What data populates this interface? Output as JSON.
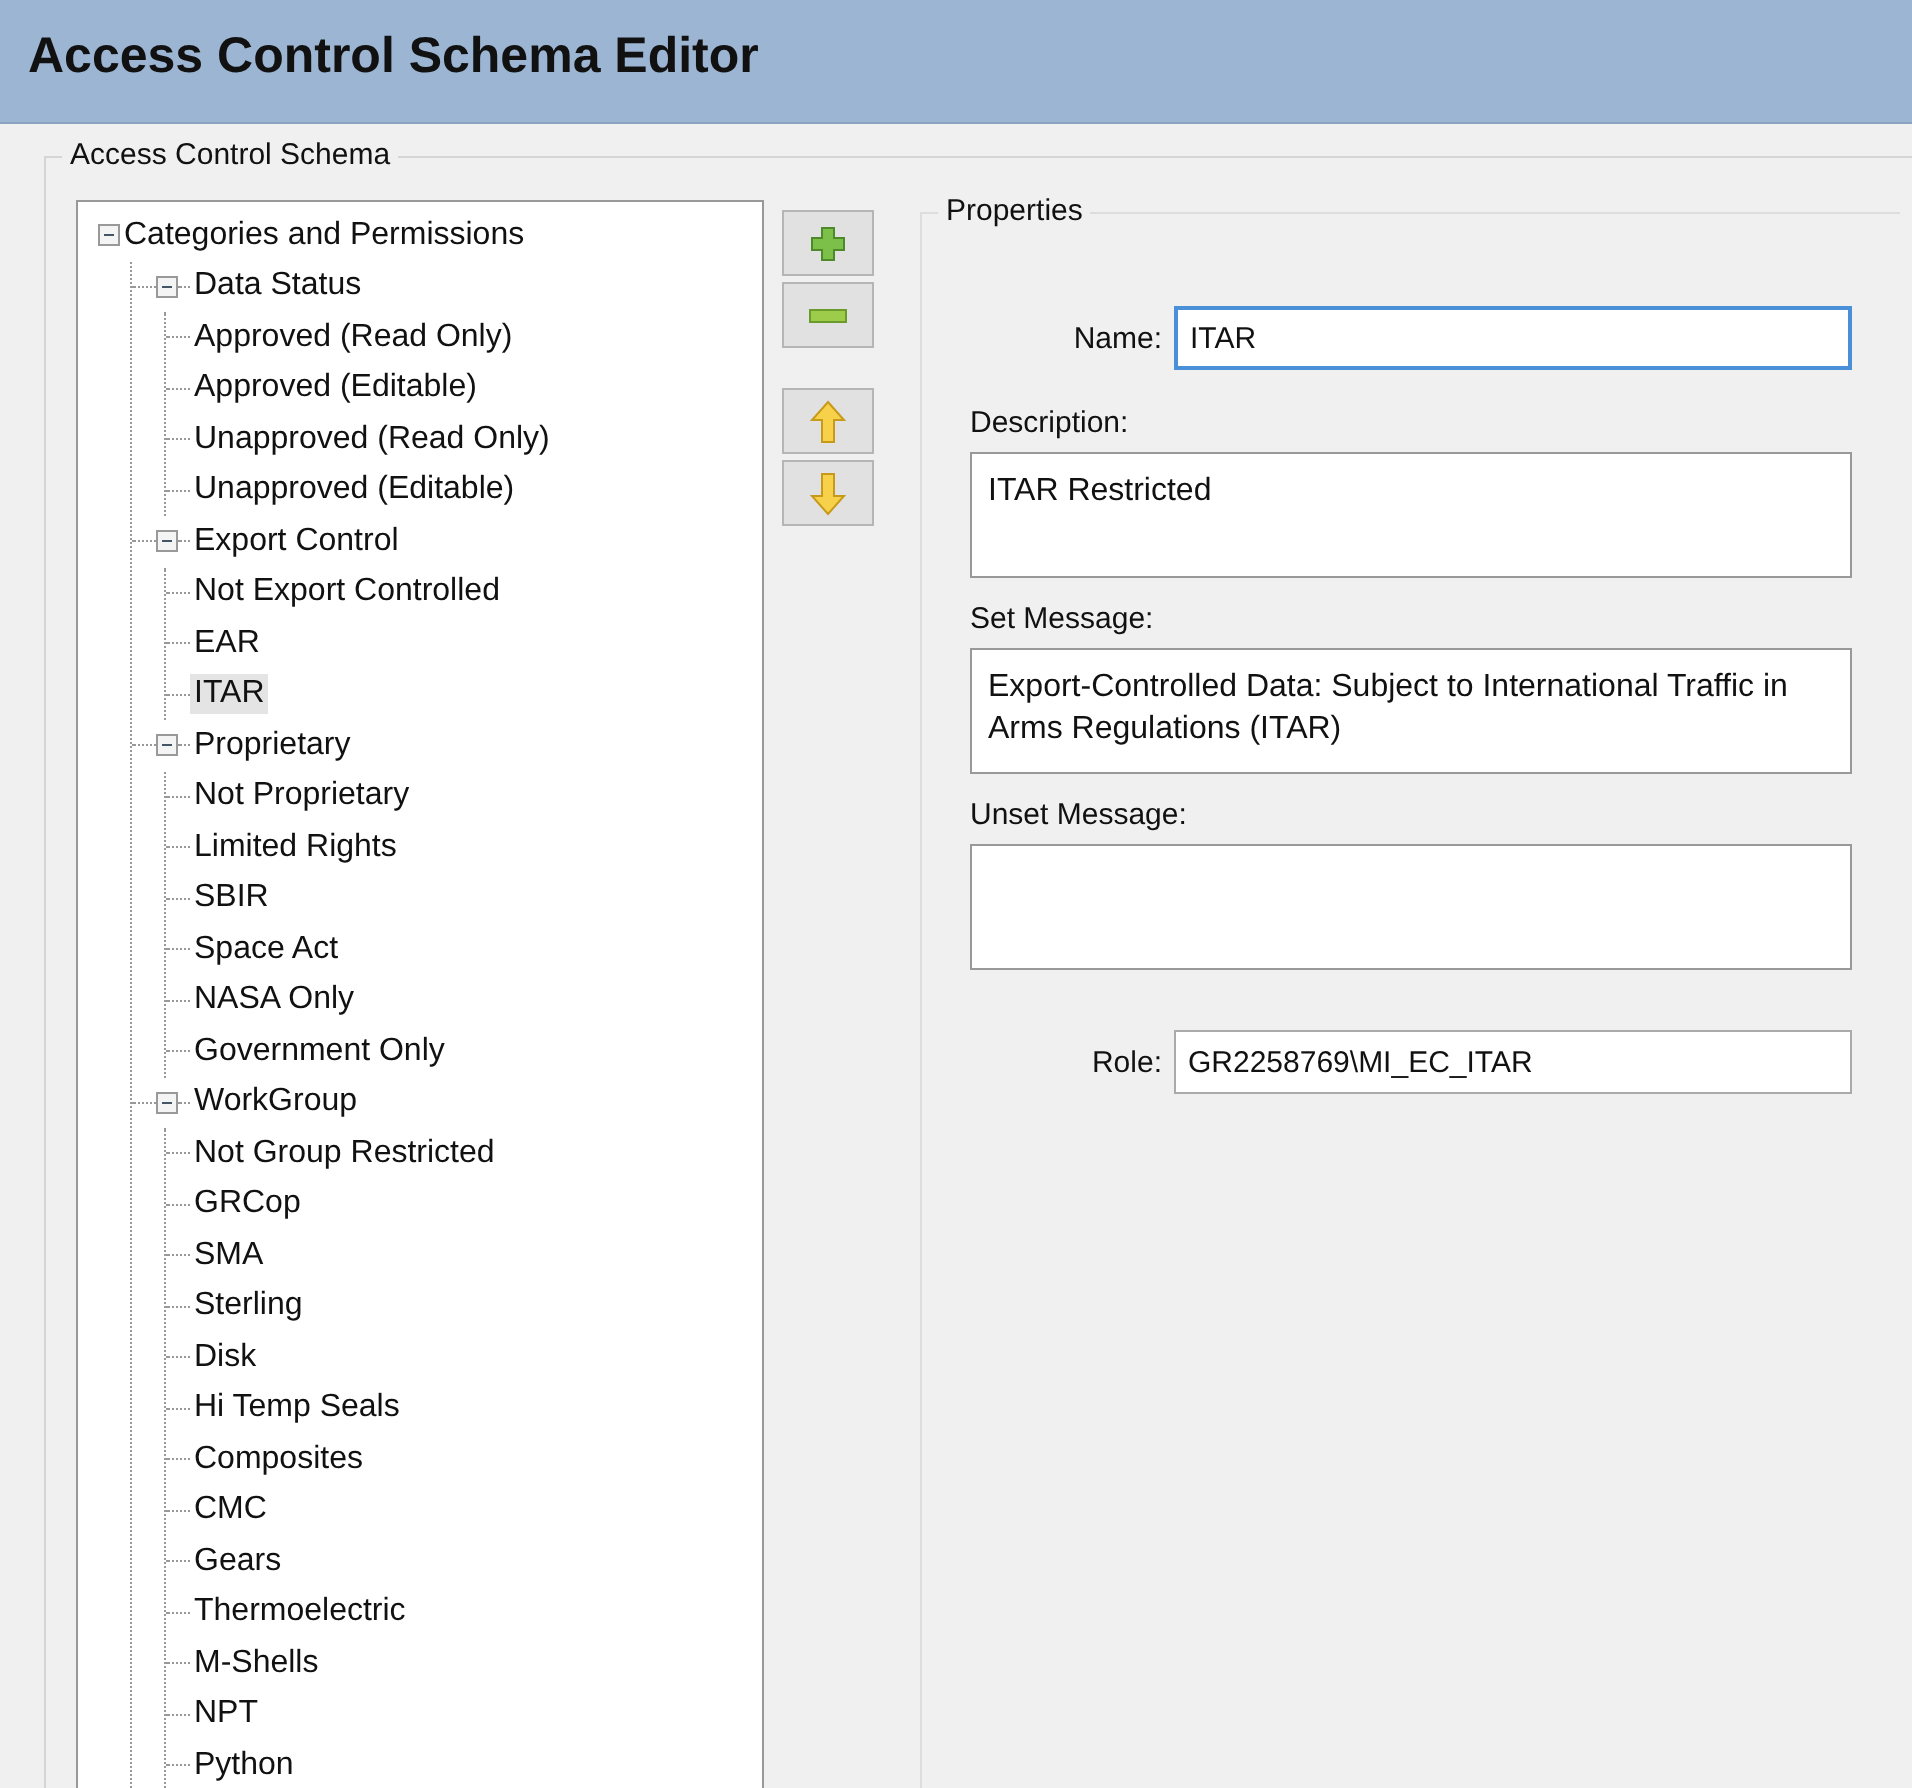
{
  "window": {
    "title": "Access Control Schema Editor"
  },
  "schema_group": {
    "title": "Access Control Schema",
    "tree": [
      {
        "label": "Categories and Permissions",
        "expanded": true,
        "selected": false,
        "children": [
          {
            "label": "Data Status",
            "expanded": true,
            "selected": false,
            "children": [
              {
                "label": "Approved (Read Only)",
                "selected": false
              },
              {
                "label": "Approved (Editable)",
                "selected": false
              },
              {
                "label": "Unapproved (Read Only)",
                "selected": false
              },
              {
                "label": "Unapproved (Editable)",
                "selected": false
              }
            ]
          },
          {
            "label": "Export Control",
            "expanded": true,
            "selected": false,
            "children": [
              {
                "label": "Not Export Controlled",
                "selected": false
              },
              {
                "label": "EAR",
                "selected": false
              },
              {
                "label": "ITAR",
                "selected": true
              }
            ]
          },
          {
            "label": "Proprietary",
            "expanded": true,
            "selected": false,
            "children": [
              {
                "label": "Not Proprietary",
                "selected": false
              },
              {
                "label": "Limited Rights",
                "selected": false
              },
              {
                "label": "SBIR",
                "selected": false
              },
              {
                "label": "Space Act",
                "selected": false
              },
              {
                "label": "NASA Only",
                "selected": false
              },
              {
                "label": "Government Only",
                "selected": false
              }
            ]
          },
          {
            "label": "WorkGroup",
            "expanded": true,
            "selected": false,
            "children": [
              {
                "label": "Not Group Restricted",
                "selected": false
              },
              {
                "label": "GRCop",
                "selected": false
              },
              {
                "label": "SMA",
                "selected": false
              },
              {
                "label": "Sterling",
                "selected": false
              },
              {
                "label": "Disk",
                "selected": false
              },
              {
                "label": "Hi Temp Seals",
                "selected": false
              },
              {
                "label": "Composites",
                "selected": false
              },
              {
                "label": "CMC",
                "selected": false
              },
              {
                "label": "Gears",
                "selected": false
              },
              {
                "label": "Thermoelectric",
                "selected": false
              },
              {
                "label": "M-Shells",
                "selected": false
              },
              {
                "label": "NPT",
                "selected": false
              },
              {
                "label": "Python",
                "selected": false
              }
            ]
          }
        ]
      }
    ],
    "buttons": [
      {
        "kind": "add"
      },
      {
        "kind": "remove"
      },
      {
        "kind": "up"
      },
      {
        "kind": "down"
      }
    ],
    "properties": {
      "title": "Properties",
      "fields": [
        {
          "kind": "inline",
          "label": "Name:",
          "value": "ITAR",
          "focused": true
        },
        {
          "kind": "stacked",
          "label": "Description:",
          "value": "ITAR Restricted"
        },
        {
          "kind": "stacked",
          "label": "Set Message:",
          "value": "Export-Controlled Data: Subject to International Traffic in Arms Regulations (ITAR)"
        },
        {
          "kind": "stacked",
          "label": "Unset Message:"
        },
        {
          "kind": "inline",
          "label": "Role:",
          "value": "GR2258769\\MI_EC_ITAR",
          "focused": false
        }
      ]
    }
  }
}
